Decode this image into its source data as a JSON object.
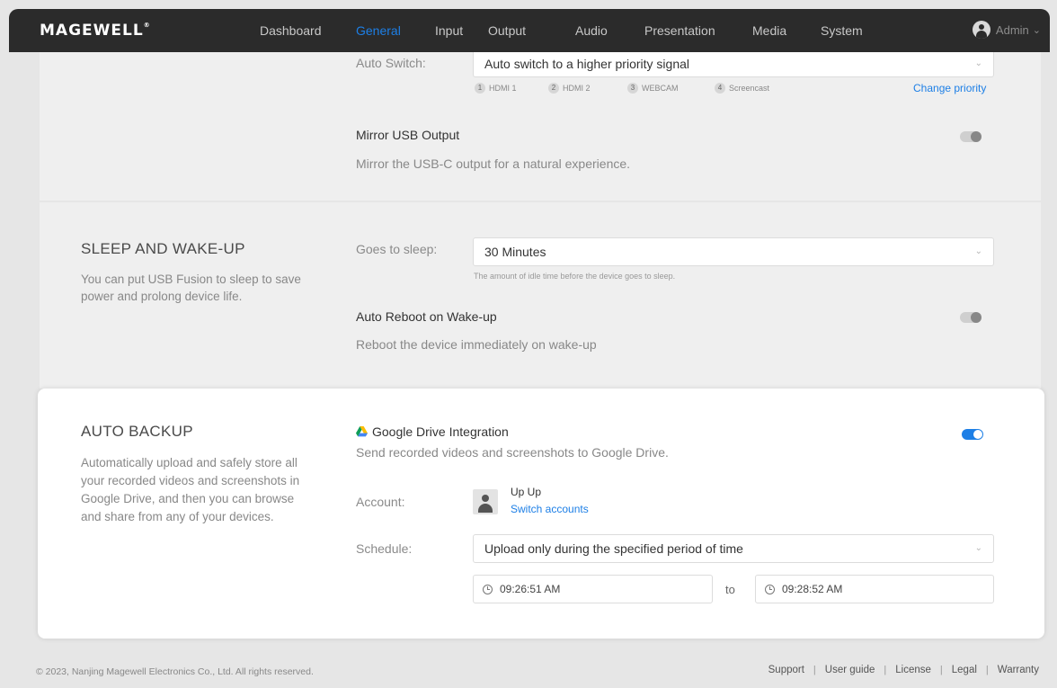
{
  "brand": {
    "logo": "MAGEWELL"
  },
  "nav": {
    "items": [
      {
        "label": "Dashboard"
      },
      {
        "label": "General"
      },
      {
        "label": "Input"
      },
      {
        "label": "Output"
      },
      {
        "label": "Audio"
      },
      {
        "label": "Presentation"
      },
      {
        "label": "Media"
      },
      {
        "label": "System"
      }
    ],
    "active": "General",
    "user": "Admin"
  },
  "auto_switch": {
    "label": "Auto Switch:",
    "value": "Auto switch to a higher priority signal",
    "priorities": [
      {
        "num": "1",
        "name": "HDMI 1"
      },
      {
        "num": "2",
        "name": "HDMI 2"
      },
      {
        "num": "3",
        "name": "WEBCAM"
      },
      {
        "num": "4",
        "name": "Screencast"
      }
    ],
    "change_priority": "Change priority"
  },
  "mirror_usb": {
    "title": "Mirror USB Output",
    "desc": "Mirror the USB-C output for a natural experience.",
    "enabled": false
  },
  "sleep": {
    "title": "SLEEP AND WAKE-UP",
    "desc": "You can put USB Fusion to sleep to save power and prolong device life.",
    "goes_to_sleep_label": "Goes to sleep:",
    "goes_to_sleep_value": "30 Minutes",
    "hint": "The amount of idle time before the device goes to sleep.",
    "auto_reboot_title": "Auto Reboot on Wake-up",
    "auto_reboot_desc": "Reboot the device immediately on wake-up",
    "auto_reboot_enabled": false
  },
  "backup": {
    "title": "AUTO BACKUP",
    "desc": "Automatically upload and safely store all your recorded videos and screenshots in Google Drive, and then you can browse and share from any of your devices.",
    "gdrive_title": "Google Drive Integration",
    "gdrive_desc": "Send recorded videos and screenshots to Google Drive.",
    "gdrive_enabled": true,
    "account_label": "Account:",
    "account_name": "Up Up",
    "switch_accounts": "Switch accounts",
    "schedule_label": "Schedule:",
    "schedule_value": "Upload only during the specified period of time",
    "time_from": "09:26:51 AM",
    "time_to_label": "to",
    "time_to": "09:28:52 AM"
  },
  "footer": {
    "copyright": "© 2023, Nanjing Magewell Electronics Co., Ltd. All rights reserved.",
    "links": [
      "Support",
      "User guide",
      "License",
      "Legal",
      "Warranty"
    ]
  },
  "colors": {
    "accent": "#1d7fe6",
    "nav_bg": "#2b2b2b",
    "page_bg": "#e6e6e6"
  }
}
